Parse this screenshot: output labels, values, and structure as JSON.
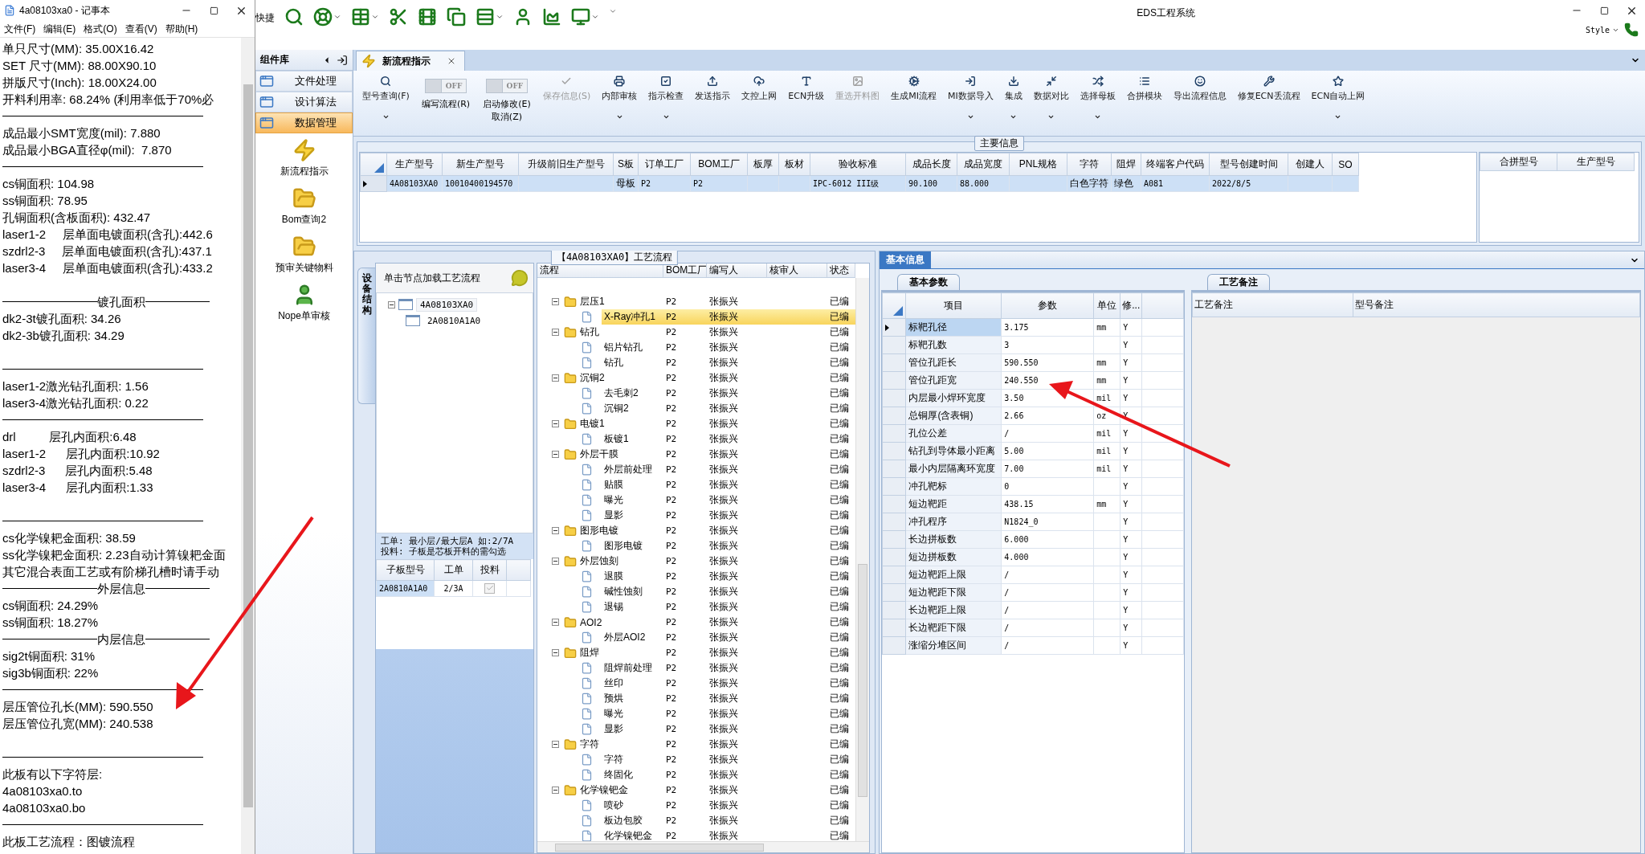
{
  "notepad": {
    "title": "4a08103xa0 - 记事本",
    "menu": [
      "文件(F)",
      "编辑(E)",
      "格式(O)",
      "查看(V)",
      "帮助(H)"
    ],
    "lines": [
      {
        "kind": "text",
        "text": "单只尺寸(MM): 35.00X16.42"
      },
      {
        "kind": "text",
        "text": "SET 尺寸(MM): 88.00X90.10"
      },
      {
        "kind": "text",
        "text": "拼版尺寸(Inch): 18.00X24.00"
      },
      {
        "kind": "text",
        "text": "开料利用率: 68.24% (利用率低于70%必"
      },
      {
        "kind": "rule"
      },
      {
        "kind": "text",
        "text": "成品最小SMT宽度(mil): 7.880"
      },
      {
        "kind": "text",
        "text": "成品最小BGA直径φ(mil):  7.870"
      },
      {
        "kind": "rule"
      },
      {
        "kind": "text",
        "text": "cs铜面积: 104.98"
      },
      {
        "kind": "text",
        "text": "ss铜面积: 78.95"
      },
      {
        "kind": "text",
        "text": "孔铜面积(含板面积): 432.47"
      },
      {
        "kind": "text",
        "text": "laser1-2     层单面电镀面积(含孔):442.6"
      },
      {
        "kind": "text",
        "text": "szdrl2-3     层单面电镀面积(含孔):437.1"
      },
      {
        "kind": "text",
        "text": "laser3-4     层单面电镀面积(含孔):433.2"
      },
      {
        "kind": "blank"
      },
      {
        "kind": "heading",
        "text": "镀孔面积"
      },
      {
        "kind": "text",
        "text": "dk2-3t镀孔面积: 34.26"
      },
      {
        "kind": "text",
        "text": "dk2-3b镀孔面积: 34.29"
      },
      {
        "kind": "blank"
      },
      {
        "kind": "rule"
      },
      {
        "kind": "text",
        "text": "laser1-2激光钻孔面积: 1.56"
      },
      {
        "kind": "text",
        "text": "laser3-4激光钻孔面积: 0.22"
      },
      {
        "kind": "rule"
      },
      {
        "kind": "text",
        "text": "drl          层孔内面积:6.48"
      },
      {
        "kind": "text",
        "text": "laser1-2      层孔内面积:10.92"
      },
      {
        "kind": "text",
        "text": "szdrl2-3      层孔内面积:5.48"
      },
      {
        "kind": "text",
        "text": "laser3-4      层孔内面积:1.33"
      },
      {
        "kind": "blank"
      },
      {
        "kind": "rule"
      },
      {
        "kind": "text",
        "text": "cs化学镍耙金面积: 38.59"
      },
      {
        "kind": "text",
        "text": "ss化学镍耙金面积: 2.23自动计算镍耙金面"
      },
      {
        "kind": "text",
        "text": "其它混合表面工艺或有阶梯孔槽时请手动"
      },
      {
        "kind": "heading",
        "text": "外层信息"
      },
      {
        "kind": "text",
        "text": "cs铜面积: 24.29%"
      },
      {
        "kind": "text",
        "text": "ss铜面积: 18.27%"
      },
      {
        "kind": "heading",
        "text": "内层信息"
      },
      {
        "kind": "text",
        "text": "sig2t铜面积: 31%"
      },
      {
        "kind": "text",
        "text": "sig3b铜面积: 22%"
      },
      {
        "kind": "rule"
      },
      {
        "kind": "text",
        "text": "层压管位孔长(MM): 590.550"
      },
      {
        "kind": "text",
        "text": "层压管位孔宽(MM): 240.538"
      },
      {
        "kind": "blank"
      },
      {
        "kind": "rule"
      },
      {
        "kind": "text",
        "text": "此板有以下字符层:"
      },
      {
        "kind": "text",
        "text": "4a08103xa0.to"
      },
      {
        "kind": "text",
        "text": "4a08103xa0.bo"
      },
      {
        "kind": "rule"
      },
      {
        "kind": "text",
        "text": "此板工艺流程：图镀流程"
      }
    ]
  },
  "app": {
    "quick_label": "快捷",
    "title": "EDS工程系统",
    "style_label": "Style"
  },
  "sidebar": {
    "title": "组件库",
    "categories": [
      {
        "label": "文件处理",
        "selected": false
      },
      {
        "label": "设计算法",
        "selected": false
      },
      {
        "label": "数据管理",
        "selected": true
      }
    ],
    "items": [
      "新流程指示",
      "Bom查询2",
      "预审关键物料",
      "Nope单审核"
    ]
  },
  "tab": {
    "label": "新流程指示"
  },
  "ribbon": [
    {
      "kind": "button",
      "label": "型号查询(F)",
      "disabled": false,
      "dropdown": true
    },
    {
      "kind": "toggle",
      "state": "OFF",
      "on": false,
      "label": "编写流程(R)"
    },
    {
      "kind": "toggle",
      "state": "OFF",
      "on": false,
      "label": "启动修改(E)\n取消(Z)"
    },
    {
      "kind": "button",
      "label": "保存信息(S)",
      "disabled": true,
      "dropdown": false
    },
    {
      "kind": "button",
      "label": "内部审核",
      "disabled": false,
      "dropdown": true
    },
    {
      "kind": "button",
      "label": "指示检查",
      "disabled": false,
      "dropdown": true
    },
    {
      "kind": "button",
      "label": "发送指示",
      "disabled": false,
      "dropdown": false
    },
    {
      "kind": "button",
      "label": "文控上网",
      "disabled": false,
      "dropdown": false
    },
    {
      "kind": "button",
      "label": "ECN升级",
      "disabled": false,
      "dropdown": false
    },
    {
      "kind": "button",
      "label": "重选开料图",
      "disabled": true,
      "dropdown": false
    },
    {
      "kind": "button",
      "label": "生成MI流程",
      "disabled": false,
      "dropdown": false
    },
    {
      "kind": "button",
      "label": "MI数据导入",
      "disabled": false,
      "dropdown": true
    },
    {
      "kind": "button",
      "label": "集成",
      "disabled": false,
      "dropdown": true
    },
    {
      "kind": "button",
      "label": "数据对比",
      "disabled": false,
      "dropdown": true
    },
    {
      "kind": "button",
      "label": "选择母板",
      "disabled": false,
      "dropdown": true
    },
    {
      "kind": "button",
      "label": "合拼模块",
      "disabled": false,
      "dropdown": false
    },
    {
      "kind": "button",
      "label": "导出流程信息",
      "disabled": false,
      "dropdown": false
    },
    {
      "kind": "button",
      "label": "修复ECN丢流程",
      "disabled": false,
      "dropdown": false
    },
    {
      "kind": "button",
      "label": "ECN自动上网",
      "disabled": false,
      "dropdown": true
    }
  ],
  "main_info": {
    "title": "主要信息",
    "columns": [
      "生产型号",
      "新生产型号",
      "升级前旧生产型号",
      "S板",
      "订单工厂",
      "BOM工厂",
      "板厚",
      "板材",
      "验收标准",
      "成品长度",
      "成品宽度",
      "PNL规格",
      "字符",
      "阻焊",
      "终端客户代码",
      "型号创建时间",
      "创建人",
      "SO"
    ],
    "rows": [
      {
        "selected": true,
        "cells": [
          "4A08103XA0",
          "10010400194570",
          null,
          "母板",
          "P2",
          "P2",
          null,
          null,
          "IPC-6012 III级",
          "90.100",
          "88.000",
          null,
          "白色字符",
          "绿色",
          "A081",
          "2022/8/5",
          null,
          null
        ]
      }
    ]
  },
  "merge_table": {
    "columns": [
      "合拼型号",
      "生产型号"
    ]
  },
  "process": {
    "title": "【4A08103XA0】工艺流程",
    "side_tab": "设备结构",
    "hint": "单击节点加载工艺流程",
    "structure": [
      {
        "label": "4A08103XA0",
        "expanded": true,
        "children": [
          {
            "label": "2A0810A1A0"
          }
        ]
      }
    ],
    "note": [
      "工单: 最小层/最大层A 如:2/7A",
      "投料: 子板是芯板开料的需勾选"
    ],
    "sub_table": {
      "columns": [
        "子板型号",
        "工单",
        "投料"
      ],
      "rows": [
        {
          "board": "2A0810A1A0",
          "order": "2/3A",
          "checked": true
        }
      ]
    },
    "flow": {
      "columns": [
        "流程",
        "BOM工厂",
        "编写人",
        "核审人",
        "状态"
      ],
      "steps": [
        {
          "name": "层压1",
          "bom": "P2",
          "writer": "张振兴",
          "status": "已编",
          "selected": false,
          "expanded": true,
          "children": [
            {
              "name": "X-Ray冲孔1",
              "bom": "P2",
              "writer": "张振兴",
              "status": "已编",
              "selected": true
            }
          ]
        },
        {
          "name": "钻孔",
          "bom": "P2",
          "writer": "张振兴",
          "status": "已编",
          "selected": false,
          "expanded": true,
          "children": [
            {
              "name": "铝片钻孔",
              "bom": "P2",
              "writer": "张振兴",
              "status": "已编",
              "selected": false
            },
            {
              "name": "钻孔",
              "bom": "P2",
              "writer": "张振兴",
              "status": "已编",
              "selected": false
            }
          ]
        },
        {
          "name": "沉铜2",
          "bom": "P2",
          "writer": "张振兴",
          "status": "已编",
          "selected": false,
          "expanded": true,
          "children": [
            {
              "name": "去毛刺2",
              "bom": "P2",
              "writer": "张振兴",
              "status": "已编",
              "selected": false
            },
            {
              "name": "沉铜2",
              "bom": "P2",
              "writer": "张振兴",
              "status": "已编",
              "selected": false
            }
          ]
        },
        {
          "name": "电镀1",
          "bom": "P2",
          "writer": "张振兴",
          "status": "已编",
          "selected": false,
          "expanded": true,
          "children": [
            {
              "name": "板镀1",
              "bom": "P2",
              "writer": "张振兴",
              "status": "已编",
              "selected": false
            }
          ]
        },
        {
          "name": "外层干膜",
          "bom": "P2",
          "writer": "张振兴",
          "status": "已编",
          "selected": false,
          "expanded": true,
          "children": [
            {
              "name": "外层前处理",
              "bom": "P2",
              "writer": "张振兴",
              "status": "已编",
              "selected": false
            },
            {
              "name": "贴膜",
              "bom": "P2",
              "writer": "张振兴",
              "status": "已编",
              "selected": false
            },
            {
              "name": "曝光",
              "bom": "P2",
              "writer": "张振兴",
              "status": "已编",
              "selected": false
            },
            {
              "name": "显影",
              "bom": "P2",
              "writer": "张振兴",
              "status": "已编",
              "selected": false
            }
          ]
        },
        {
          "name": "图形电镀",
          "bom": "P2",
          "writer": "张振兴",
          "status": "已编",
          "selected": false,
          "expanded": true,
          "children": [
            {
              "name": "图形电镀",
              "bom": "P2",
              "writer": "张振兴",
              "status": "已编",
              "selected": false
            }
          ]
        },
        {
          "name": "外层蚀刻",
          "bom": "P2",
          "writer": "张振兴",
          "status": "已编",
          "selected": false,
          "expanded": true,
          "children": [
            {
              "name": "退膜",
              "bom": "P2",
              "writer": "张振兴",
              "status": "已编",
              "selected": false
            },
            {
              "name": "碱性蚀刻",
              "bom": "P2",
              "writer": "张振兴",
              "status": "已编",
              "selected": false
            },
            {
              "name": "退锡",
              "bom": "P2",
              "writer": "张振兴",
              "status": "已编",
              "selected": false
            }
          ]
        },
        {
          "name": "AOI2",
          "bom": "P2",
          "writer": "张振兴",
          "status": "已编",
          "selected": false,
          "expanded": true,
          "children": [
            {
              "name": "外层AOI2",
              "bom": "P2",
              "writer": "张振兴",
              "status": "已编",
              "selected": false
            }
          ]
        },
        {
          "name": "阻焊",
          "bom": "P2",
          "writer": "张振兴",
          "status": "已编",
          "selected": false,
          "expanded": true,
          "children": [
            {
              "name": "阻焊前处理",
              "bom": "P2",
              "writer": "张振兴",
              "status": "已编",
              "selected": false
            },
            {
              "name": "丝印",
              "bom": "P2",
              "writer": "张振兴",
              "status": "已编",
              "selected": false
            },
            {
              "name": "预烘",
              "bom": "P2",
              "writer": "张振兴",
              "status": "已编",
              "selected": false
            },
            {
              "name": "曝光",
              "bom": "P2",
              "writer": "张振兴",
              "status": "已编",
              "selected": false
            },
            {
              "name": "显影",
              "bom": "P2",
              "writer": "张振兴",
              "status": "已编",
              "selected": false
            }
          ]
        },
        {
          "name": "字符",
          "bom": "P2",
          "writer": "张振兴",
          "status": "已编",
          "selected": false,
          "expanded": true,
          "children": [
            {
              "name": "字符",
              "bom": "P2",
              "writer": "张振兴",
              "status": "已编",
              "selected": false
            },
            {
              "name": "终固化",
              "bom": "P2",
              "writer": "张振兴",
              "status": "已编",
              "selected": false
            }
          ]
        },
        {
          "name": "化学镍钯金",
          "bom": "P2",
          "writer": "张振兴",
          "status": "已编",
          "selected": false,
          "expanded": true,
          "children": [
            {
              "name": "喷砂",
              "bom": "P2",
              "writer": "张振兴",
              "status": "已编",
              "selected": false
            },
            {
              "name": "板边包胶",
              "bom": "P2",
              "writer": "张振兴",
              "status": "已编",
              "selected": false
            },
            {
              "name": "化学镍钯金",
              "bom": "P2",
              "writer": "张振兴",
              "status": "已编",
              "selected": false
            }
          ]
        }
      ]
    }
  },
  "basic_info": {
    "tab": "基本信息",
    "subtab": "基本参数",
    "columns": [
      "项目",
      "参数",
      "单位",
      "修..."
    ],
    "rows": [
      {
        "item": "标靶孔径",
        "value": "3.175",
        "unit": "mm",
        "flag": "Y",
        "selected": true
      },
      {
        "item": "标靶孔数",
        "value": "3",
        "flag": "Y",
        "selected": false
      },
      {
        "item": "管位孔距长",
        "value": "590.550",
        "unit": "mm",
        "flag": "Y",
        "selected": false
      },
      {
        "item": "管位孔距宽",
        "value": "240.550",
        "unit": "mm",
        "flag": "Y",
        "selected": false
      },
      {
        "item": "内层最小焊环宽度",
        "value": "3.50",
        "unit": "mil",
        "flag": "Y",
        "selected": false
      },
      {
        "item": "总铜厚(含表铜)",
        "value": "2.66",
        "unit": "oz",
        "flag": "Y",
        "selected": false
      },
      {
        "item": "孔位公差",
        "value": "/",
        "unit": "mil",
        "flag": "Y",
        "selected": false
      },
      {
        "item": "钻孔到导体最小距离",
        "value": "5.00",
        "unit": "mil",
        "flag": "Y",
        "selected": false
      },
      {
        "item": "最小内层隔离环宽度",
        "value": "7.00",
        "unit": "mil",
        "flag": "Y",
        "selected": false
      },
      {
        "item": "冲孔靶标",
        "value": "0",
        "flag": "Y",
        "selected": false
      },
      {
        "item": "短边靶距",
        "value": "438.15",
        "unit": "mm",
        "flag": "Y",
        "selected": false
      },
      {
        "item": "冲孔程序",
        "value": "N1824_0",
        "flag": "Y",
        "selected": false
      },
      {
        "item": "长边拼板数",
        "value": "6.000",
        "flag": "Y",
        "selected": false
      },
      {
        "item": "短边拼板数",
        "value": "4.000",
        "flag": "Y",
        "selected": false
      },
      {
        "item": "短边靶距上限",
        "value": "/",
        "flag": "Y",
        "selected": false
      },
      {
        "item": "短边靶距下限",
        "value": "/",
        "flag": "Y",
        "selected": false
      },
      {
        "item": "长边靶距上限",
        "value": "/",
        "flag": "Y",
        "selected": false
      },
      {
        "item": "长边靶距下限",
        "value": "/",
        "flag": "Y",
        "selected": false
      },
      {
        "item": "涨缩分堆区间",
        "value": "/",
        "flag": "Y",
        "selected": false
      }
    ]
  },
  "remarks": {
    "tab": "工艺备注",
    "columns": [
      "工艺备注",
      "型号备注"
    ]
  }
}
